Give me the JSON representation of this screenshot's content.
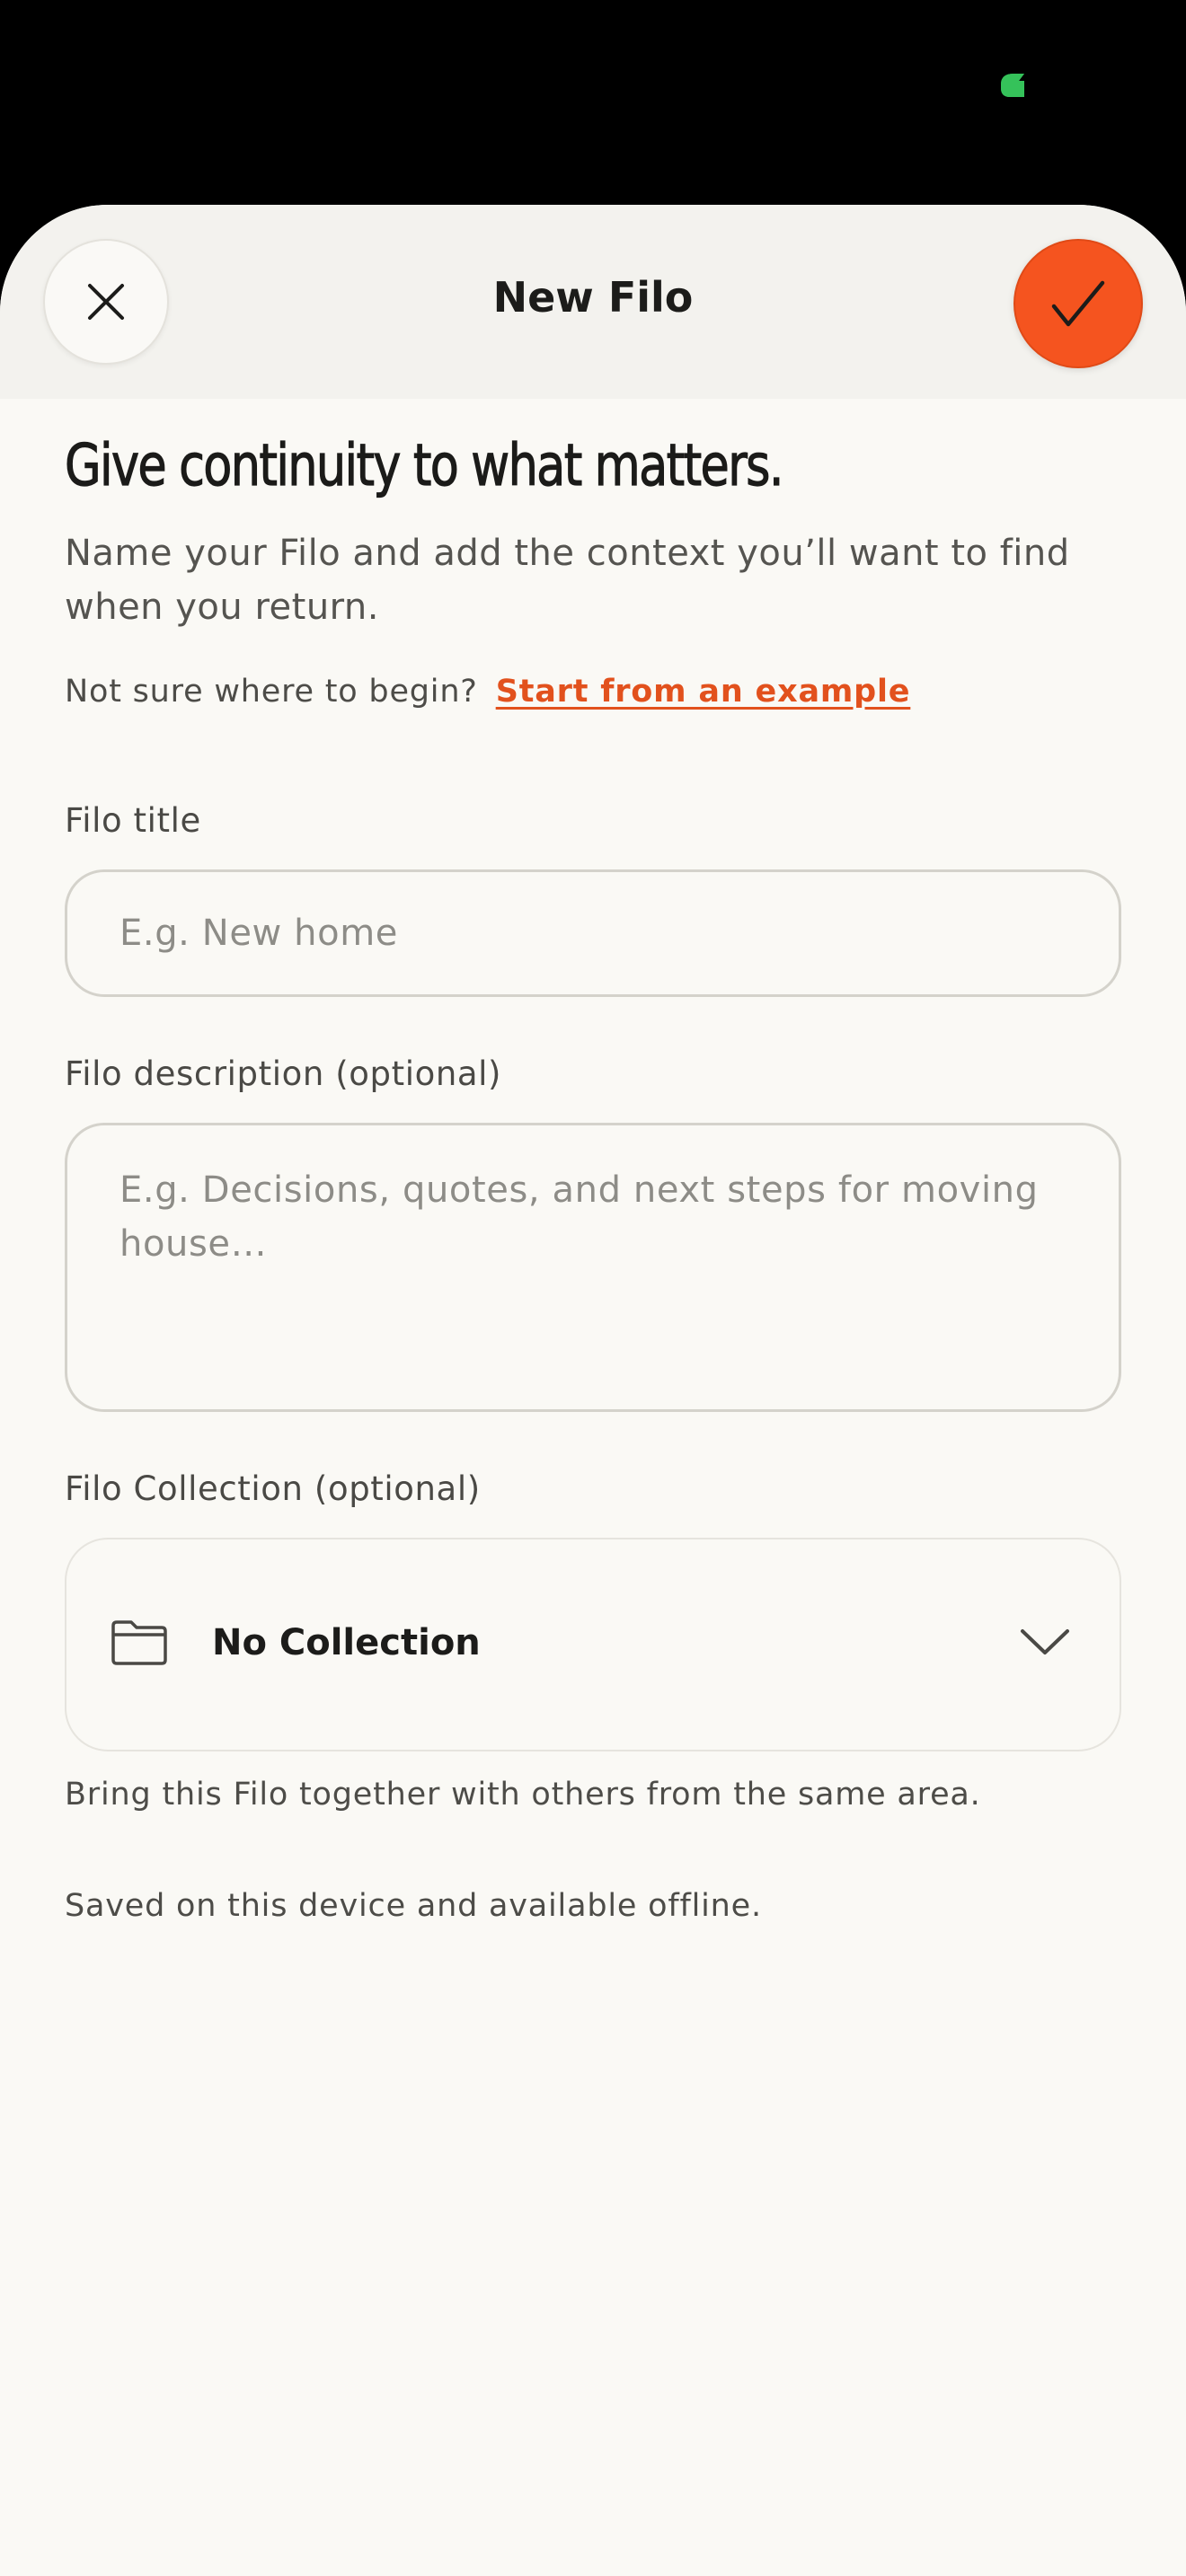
{
  "nav": {
    "title": "New Filo",
    "close_icon": "close-icon",
    "confirm_icon": "checkmark-icon"
  },
  "intro": {
    "headline": "Give continuity to what matters.",
    "subtitle": "Name your Filo and add the context you’ll want to find when you return.",
    "example_prompt": "Not sure where to begin?",
    "example_link": "Start from an example"
  },
  "form": {
    "title_field": {
      "label": "Filo title",
      "value": "",
      "placeholder": "E.g. New home"
    },
    "description_field": {
      "label": "Filo description (optional)",
      "value": "",
      "placeholder": "E.g. Decisions, quotes, and next steps for moving house…"
    },
    "collection_field": {
      "label": "Filo Collection (optional)",
      "selected": "No Collection",
      "icon": "folder-icon",
      "dropdown_icon": "chevron-down-icon",
      "helper": "Bring this Filo together with others from the same area."
    },
    "storage_note": "Saved on this device and available offline."
  },
  "colors": {
    "accent": "#f5541f",
    "link": "#e2511d",
    "background": "#faf9f5",
    "nav_background": "#f3f2ee",
    "status_indicator": "#35c25a"
  }
}
